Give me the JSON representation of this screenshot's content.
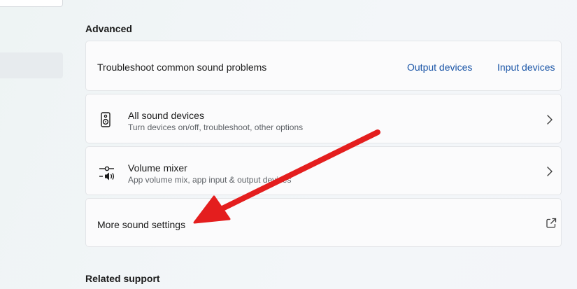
{
  "sections": {
    "advanced": "Advanced",
    "related_support": "Related support"
  },
  "troubleshoot": {
    "label": "Troubleshoot common sound problems",
    "output_link": "Output devices",
    "input_link": "Input devices"
  },
  "all_sound_devices": {
    "title": "All sound devices",
    "subtitle": "Turn devices on/off, troubleshoot, other options",
    "icon": "speaker-icon"
  },
  "volume_mixer": {
    "title": "Volume mixer",
    "subtitle": "App volume mix, app input & output devices",
    "icon": "mixer-icon"
  },
  "more_sound_settings": {
    "title": "More sound settings",
    "icon": "external-link-icon"
  },
  "annotation": {
    "arrow_color": "#e41e1e"
  },
  "colors": {
    "link": "#1a55a7",
    "card_bg": "#fbfbfc",
    "page_bg": "#f2f5f8"
  }
}
